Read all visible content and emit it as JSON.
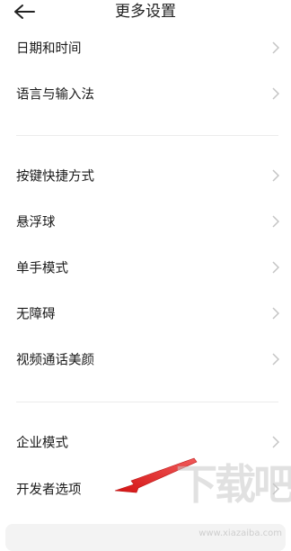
{
  "header": {
    "title": "更多设置",
    "back_icon": "arrow-left-icon"
  },
  "settings": {
    "group1": [
      {
        "label": "日期和时间"
      },
      {
        "label": "语言与输入法"
      }
    ],
    "group2": [
      {
        "label": "按键快捷方式"
      },
      {
        "label": "悬浮球"
      },
      {
        "label": "单手模式"
      },
      {
        "label": "无障碍"
      },
      {
        "label": "视频通话美颜"
      }
    ],
    "group3": [
      {
        "label": "企业模式"
      },
      {
        "label": "开发者选项"
      }
    ]
  },
  "annotation": {
    "arrow_color": "#e31b1b",
    "points_to": "开发者选项"
  },
  "watermark": {
    "text": "下载吧",
    "sub": "www.xiazaiba.com"
  },
  "colors": {
    "divider": "#ececec",
    "chevron": "#c4c4c4"
  }
}
